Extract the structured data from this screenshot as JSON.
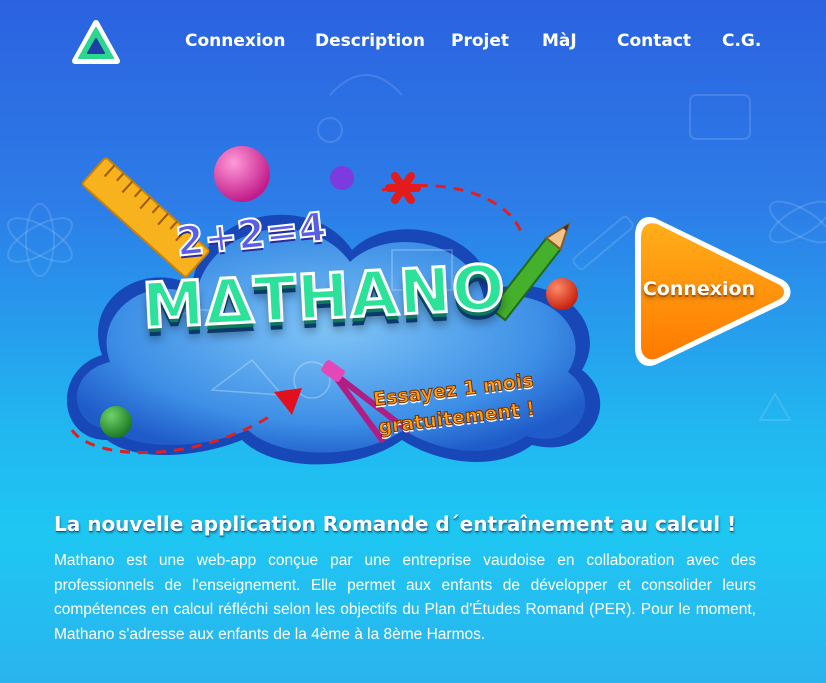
{
  "nav": {
    "logo_icon": "triangle-logo-icon",
    "links": [
      {
        "label": "Connexion"
      },
      {
        "label": "Description"
      },
      {
        "label": "Projet"
      },
      {
        "label": "MàJ"
      },
      {
        "label": "Contact"
      },
      {
        "label": "C.G."
      }
    ]
  },
  "hero": {
    "brand": "MΔTHANO",
    "equation": "2+2=4",
    "promo_line1": "Essayez 1 mois",
    "promo_line2": "gratuitement !",
    "cta_label": "Connexion"
  },
  "main": {
    "headline": "La nouvelle application Romande d´entraînement au calcul !",
    "intro": "Mathano est une web-app conçue par une entreprise vaudoise en collaboration avec des professionnels de l'enseignement. Elle permet aux enfants de développer et consolider leurs compétences en calcul réfléchi selon les objectifs du Plan d'Études Romand (PER). Pour le moment, Mathano s'adresse aux enfants de la 4ème à la 8ème Harmos."
  },
  "colors": {
    "background_top": "#2b62e0",
    "background_bottom": "#1ec7f2",
    "brand_green": "#2ce29a",
    "cta_orange": "#ff8a00",
    "promo_orange": "#ff9f12"
  }
}
